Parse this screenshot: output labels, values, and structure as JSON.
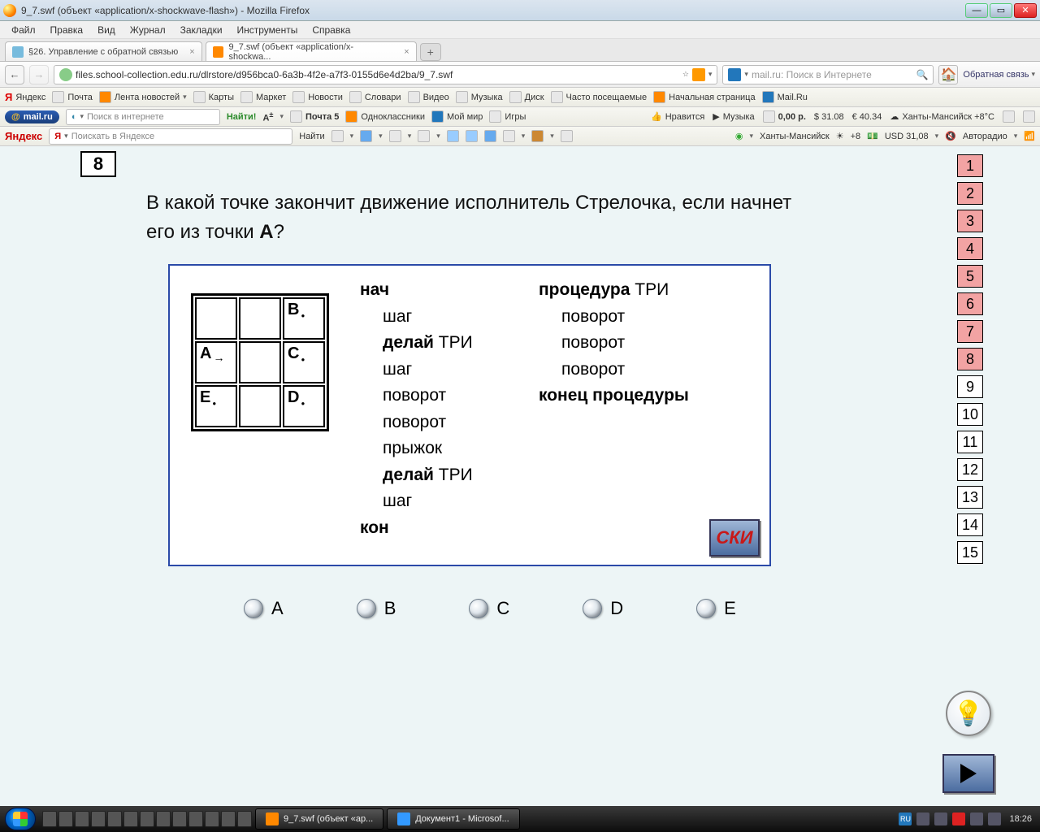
{
  "window": {
    "title": "9_7.swf (объект «application/x-shockwave-flash») - Mozilla Firefox"
  },
  "menubar": [
    "Файл",
    "Правка",
    "Вид",
    "Журнал",
    "Закладки",
    "Инструменты",
    "Справка"
  ],
  "tabs": [
    {
      "label": "§26. Управление с обратной связью",
      "active": false
    },
    {
      "label": "9_7.swf (объект «application/x-shockwa...",
      "active": true
    }
  ],
  "url": "files.school-collection.edu.ru/dlrstore/d956bca0-6a3b-4f2e-a7f3-0155d6e4d2ba/9_7.swf",
  "searchbar": {
    "placeholder": "mail.ru: Поиск в Интернете"
  },
  "feedback_label": "Обратная связь",
  "toolbar1": {
    "items": [
      "Яндекс",
      "Почта",
      "Лента новостей",
      "Карты",
      "Маркет",
      "Новости",
      "Словари",
      "Видео",
      "Музыка",
      "Диск",
      "Часто посещаемые",
      "Начальная страница",
      "Mail.Ru"
    ]
  },
  "toolbar2": {
    "brand": "mail.ru",
    "search_placeholder": "Поиск в интернете",
    "find": "Найти!",
    "items": [
      "Почта 5",
      "Одноклассники",
      "Мой мир",
      "Игры"
    ],
    "right": [
      "Нравится",
      "Музыка",
      "0,00 р.",
      "$ 31.08",
      "€ 40.34",
      "Ханты-Мансийск +8°C"
    ]
  },
  "toolbar3": {
    "brand": "Яндекс",
    "search_placeholder": "Поискать в Яндексе",
    "find": "Найти",
    "right": [
      "Ханты-Мансийск",
      "+8",
      "USD 31,08",
      "Авторадио"
    ]
  },
  "quiz": {
    "number": "8",
    "question_pre": "В какой точке закончит движение исполнитель Стрелочка, если начнет его из точки ",
    "question_bold": "А",
    "question_post": "?",
    "grid": {
      "cells": {
        "r1c3": "B",
        "r2c1": "A",
        "r2c3": "C",
        "r3c1": "E",
        "r3c3": "D"
      }
    },
    "code_left": {
      "begin": "нач",
      "lines": [
        "шаг",
        "делай ТРИ",
        "шаг",
        "поворот",
        "поворот",
        "прыжок",
        "делай ТРИ",
        "шаг"
      ],
      "end": "кон"
    },
    "code_right": {
      "head": "процедура ТРИ",
      "lines": [
        "поворот",
        "поворот",
        "поворот"
      ],
      "end": "конец процедуры"
    },
    "ski": "СКИ",
    "options": [
      "A",
      "B",
      "C",
      "D",
      "E"
    ],
    "nav": [
      1,
      2,
      3,
      4,
      5,
      6,
      7,
      8,
      9,
      10,
      11,
      12,
      13,
      14,
      15
    ],
    "nav_done": [
      1,
      2,
      3,
      4,
      5,
      6,
      7,
      8
    ],
    "nav_current": 8
  },
  "taskbar": {
    "apps": [
      {
        "label": "9_7.swf (объект «ap..."
      },
      {
        "label": "Документ1 - Microsof..."
      }
    ],
    "lang": "RU",
    "clock": "18:26"
  }
}
